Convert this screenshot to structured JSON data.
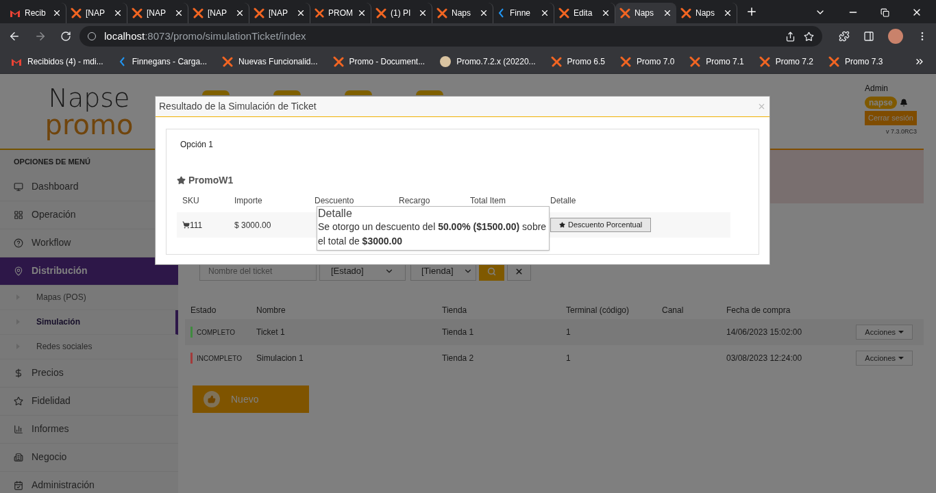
{
  "browser": {
    "tabs": [
      {
        "title": "Recib",
        "kind": "gmail",
        "selected": false
      },
      {
        "title": "[NAP",
        "kind": "napse",
        "selected": false
      },
      {
        "title": "[NAP",
        "kind": "napse",
        "selected": false
      },
      {
        "title": "[NAP",
        "kind": "napse",
        "selected": false
      },
      {
        "title": "[NAP",
        "kind": "napse",
        "selected": false
      },
      {
        "title": "PROM",
        "kind": "napse",
        "selected": false
      },
      {
        "title": "(1) PI",
        "kind": "napse",
        "selected": false
      },
      {
        "title": "Naps",
        "kind": "napse",
        "selected": false
      },
      {
        "title": "Finne",
        "kind": "finnegans",
        "selected": false
      },
      {
        "title": "Edita",
        "kind": "napse",
        "selected": false
      },
      {
        "title": "Naps",
        "kind": "napse",
        "selected": true
      },
      {
        "title": "Naps",
        "kind": "napse",
        "selected": false
      }
    ],
    "url_host": "localhost",
    "url_path": ":8073/promo/simulationTicket/index",
    "bookmarks": [
      {
        "title": "Recibidos (4) - mdi...",
        "kind": "gmail"
      },
      {
        "title": "Finnegans - Carga...",
        "kind": "finnegans"
      },
      {
        "title": "Nuevas Funcionalid...",
        "kind": "napse"
      },
      {
        "title": "Promo - Document...",
        "kind": "napse"
      },
      {
        "title": "Promo.7.2.x (20220...",
        "kind": "avatar"
      },
      {
        "title": "Promo 6.5",
        "kind": "napse"
      },
      {
        "title": "Promo 7.0",
        "kind": "napse"
      },
      {
        "title": "Promo 7.1",
        "kind": "napse"
      },
      {
        "title": "Promo 7.2",
        "kind": "napse"
      },
      {
        "title": "Promo 7.3",
        "kind": "napse"
      }
    ]
  },
  "header": {
    "logo_top": "Napse",
    "logo_bottom": "promo",
    "user": "Admin",
    "company": "napse",
    "logout": "Cerrar sesión",
    "version": "v 7.3.0RC3"
  },
  "sidebar": {
    "heading": "OPCIONES DE MENÚ",
    "items": [
      {
        "label": "Dashboard",
        "selected": false
      },
      {
        "label": "Operación",
        "selected": false
      },
      {
        "label": "Workflow",
        "selected": false
      },
      {
        "label": "Distribución",
        "selected": true,
        "children": [
          {
            "label": "Mapas (POS)",
            "selected": false
          },
          {
            "label": "Simulación",
            "selected": true
          },
          {
            "label": "Redes sociales",
            "selected": false
          }
        ]
      },
      {
        "label": "Precios",
        "selected": false
      },
      {
        "label": "Fidelidad",
        "selected": false
      },
      {
        "label": "Informes",
        "selected": false
      },
      {
        "label": "Negocio",
        "selected": false
      },
      {
        "label": "Administración",
        "selected": false
      }
    ]
  },
  "filters": {
    "name_placeholder": "Nombre del ticket",
    "status": "[Estado]",
    "store": "[Tienda]"
  },
  "table": {
    "columns": [
      "Estado",
      "Nombre",
      "Tienda",
      "Terminal (código)",
      "Canal",
      "Fecha de compra"
    ],
    "rows": [
      {
        "estado": "COMPLETO",
        "color": "#3f8a3f",
        "nombre": "Ticket 1",
        "tienda": "Tienda 1",
        "terminal": "1",
        "fecha": "14/06/2023 15:02:00",
        "action": "Acciones"
      },
      {
        "estado": "INCOMPLETO",
        "color": "#a33a3a",
        "nombre": "Simulacion 1",
        "tienda": "Tienda 2",
        "terminal": "1",
        "fecha": "03/08/2023 12:24:00",
        "action": "Acciones"
      }
    ]
  },
  "new_button": "Nuevo",
  "modal": {
    "title": "Resultado de la Simulación de Ticket",
    "tab": "Opción 1",
    "promo": "PromoW1",
    "columns": [
      "SKU",
      "Importe",
      "Descuento",
      "Recargo",
      "Total Item",
      "Detalle"
    ],
    "row": {
      "sku": "111",
      "importe": "$ 3000.00",
      "detail_button": "Descuento Porcentual"
    },
    "tooltip": {
      "title": "Detalle",
      "text": "Se otorgo un descuento del **50.00% ($1500.00)** sobre el total de **$3000.00**"
    }
  }
}
